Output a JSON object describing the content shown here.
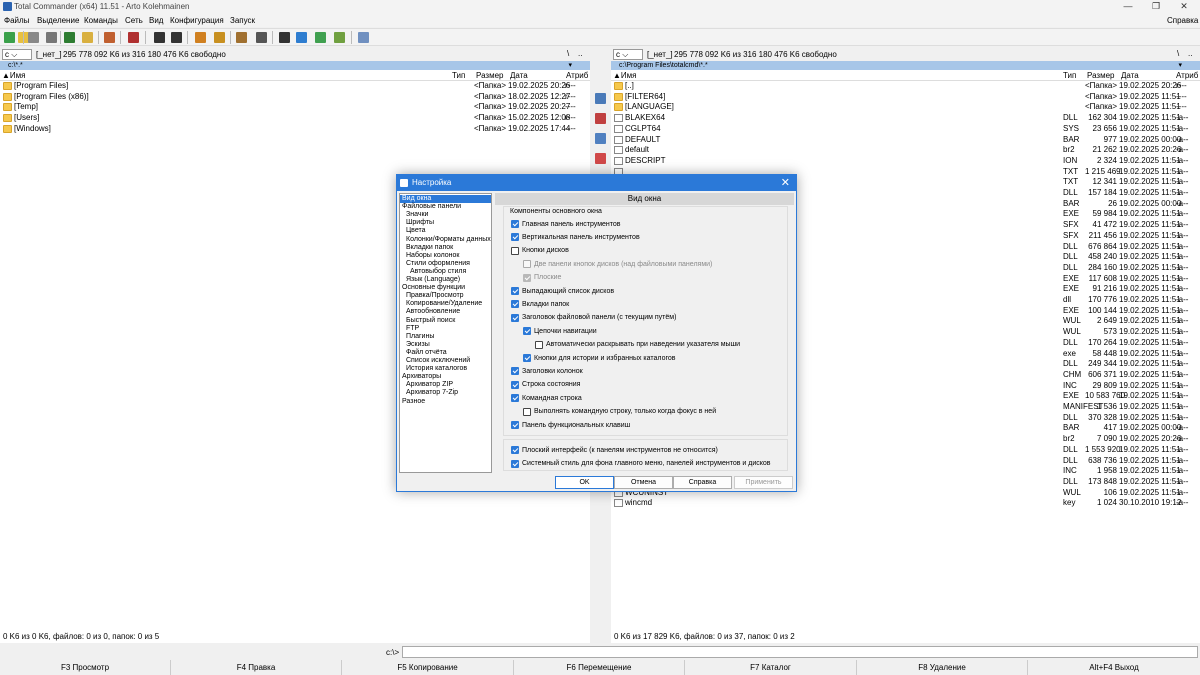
{
  "window": {
    "title": "Total Commander (x64) 11.51 - Arto Kolehmainen"
  },
  "menu": [
    "Файлы",
    "Выделение",
    "Команды",
    "Сеть",
    "Вид",
    "Конфигурация",
    "Запуск"
  ],
  "menu_help": "Справка",
  "left": {
    "drive": "c",
    "drive_label": "[_нет_]",
    "free": "295 778 092 K6 из 316 180 476 K6 свободно",
    "path": "c:\\*.*",
    "cols": {
      "name": "Имя",
      "type": "Тип",
      "size": "Размер",
      "date": "Дата",
      "attr": "Атриб"
    },
    "rows": [
      {
        "name": "[Program Files]",
        "size": "<Папка>",
        "date": "19.02.2025 20:26",
        "attr": "r---"
      },
      {
        "name": "[Program Files (x86)]",
        "size": "<Папка>",
        "date": "18.02.2025 12:27",
        "attr": "r---"
      },
      {
        "name": "[Temp]",
        "size": "<Папка>",
        "date": "19.02.2025 20:27",
        "attr": "----"
      },
      {
        "name": "[Users]",
        "size": "<Папка>",
        "date": "15.02.2025 12:08",
        "attr": "r---"
      },
      {
        "name": "[Windows]",
        "size": "<Папка>",
        "date": "19.02.2025 17:44",
        "attr": "----"
      }
    ],
    "status": "0 K6 из 0 K6, файлов: 0 из 0, папок: 0 из 5",
    "slash": "\\",
    "dots": ".."
  },
  "right": {
    "drive": "c",
    "drive_label": "[_нет_]",
    "free": "295 778 092 K6 из 316 180 476 K6 свободно",
    "path": "c:\\Program Files\\totalcmd\\*.*",
    "cols": {
      "name": "Имя",
      "type": "Тип",
      "size": "Размер",
      "date": "Дата",
      "attr": "Атриб"
    },
    "rows": [
      {
        "name": "[..]",
        "type": "",
        "size": "<Папка>",
        "date": "19.02.2025 20:26",
        "attr": "r---",
        "folder": true
      },
      {
        "name": "[FILTER64]",
        "type": "",
        "size": "<Папка>",
        "date": "19.02.2025 11:51",
        "attr": "----",
        "folder": true
      },
      {
        "name": "[LANGUAGE]",
        "type": "",
        "size": "<Папка>",
        "date": "19.02.2025 11:51",
        "attr": "----",
        "folder": true
      },
      {
        "name": "BLAKEX64",
        "type": "DLL",
        "size": "162 304",
        "date": "19.02.2025 11:51",
        "attr": "-a--"
      },
      {
        "name": "CGLPT64",
        "type": "SYS",
        "size": "23 656",
        "date": "19.02.2025 11:51",
        "attr": "-a--"
      },
      {
        "name": "DEFAULT",
        "type": "BAR",
        "size": "977",
        "date": "19.02.2025 00:00",
        "attr": "-a--"
      },
      {
        "name": "default",
        "type": "br2",
        "size": "21 262",
        "date": "19.02.2025 20:26",
        "attr": "-a--"
      },
      {
        "name": "DESCRIPT",
        "type": "ION",
        "size": "2 324",
        "date": "19.02.2025 11:51",
        "attr": "-a--"
      },
      {
        "name": "",
        "type": "TXT",
        "size": "1 215 469",
        "date": "19.02.2025 11:51",
        "attr": "-a--"
      },
      {
        "name": "",
        "type": "TXT",
        "size": "12 341",
        "date": "19.02.2025 11:51",
        "attr": "-a--"
      },
      {
        "name": "",
        "type": "DLL",
        "size": "157 184",
        "date": "19.02.2025 11:51",
        "attr": "-a--"
      },
      {
        "name": "",
        "type": "BAR",
        "size": "26",
        "date": "19.02.2025 00:00",
        "attr": "-a--"
      },
      {
        "name": "",
        "type": "EXE",
        "size": "59 984",
        "date": "19.02.2025 11:51",
        "attr": "-a--"
      },
      {
        "name": "",
        "type": "SFX",
        "size": "41 472",
        "date": "19.02.2025 11:51",
        "attr": "-a--"
      },
      {
        "name": "",
        "type": "SFX",
        "size": "211 456",
        "date": "19.02.2025 11:51",
        "attr": "-a--"
      },
      {
        "name": "",
        "type": "DLL",
        "size": "676 864",
        "date": "19.02.2025 11:51",
        "attr": "-a--"
      },
      {
        "name": "",
        "type": "DLL",
        "size": "458 240",
        "date": "19.02.2025 11:51",
        "attr": "-a--"
      },
      {
        "name": "",
        "type": "DLL",
        "size": "284 160",
        "date": "19.02.2025 11:51",
        "attr": "-a--"
      },
      {
        "name": "",
        "type": "EXE",
        "size": "117 608",
        "date": "19.02.2025 11:51",
        "attr": "-a--"
      },
      {
        "name": "",
        "type": "EXE",
        "size": "91 216",
        "date": "19.02.2025 11:51",
        "attr": "-a--"
      },
      {
        "name": "",
        "type": "dll",
        "size": "170 776",
        "date": "19.02.2025 11:51",
        "attr": "-a--"
      },
      {
        "name": "",
        "type": "EXE",
        "size": "100 144",
        "date": "19.02.2025 11:51",
        "attr": "-a--"
      },
      {
        "name": "",
        "type": "WUL",
        "size": "2 649",
        "date": "19.02.2025 11:51",
        "attr": "-a--"
      },
      {
        "name": "",
        "type": "WUL",
        "size": "573",
        "date": "19.02.2025 11:51",
        "attr": "-a--"
      },
      {
        "name": "",
        "type": "DLL",
        "size": "170 264",
        "date": "19.02.2025 11:51",
        "attr": "-a--"
      },
      {
        "name": "",
        "type": "exe",
        "size": "58 448",
        "date": "19.02.2025 11:51",
        "attr": "-a--"
      },
      {
        "name": "",
        "type": "DLL",
        "size": "249 344",
        "date": "19.02.2025 11:51",
        "attr": "-a--"
      },
      {
        "name": "",
        "type": "CHM",
        "size": "606 371",
        "date": "19.02.2025 11:51",
        "attr": "-a--"
      },
      {
        "name": "",
        "type": "INC",
        "size": "29 809",
        "date": "19.02.2025 11:51",
        "attr": "-a--"
      },
      {
        "name": "",
        "type": "EXE",
        "size": "10 583 760",
        "date": "19.02.2025 11:51",
        "attr": "-a--"
      },
      {
        "name": "",
        "type": "MANIFEST",
        "size": "1 536",
        "date": "19.02.2025 11:51",
        "attr": "-a--"
      },
      {
        "name": "",
        "type": "DLL",
        "size": "370 328",
        "date": "19.02.2025 11:51",
        "attr": "-a--"
      },
      {
        "name": "",
        "type": "BAR",
        "size": "417",
        "date": "19.02.2025 00:00",
        "attr": "-a--"
      },
      {
        "name": "",
        "type": "br2",
        "size": "7 090",
        "date": "19.02.2025 20:26",
        "attr": "-a--"
      },
      {
        "name": "",
        "type": "DLL",
        "size": "1 553 920",
        "date": "19.02.2025 11:51",
        "attr": "-a--"
      },
      {
        "name": "",
        "type": "DLL",
        "size": "638 736",
        "date": "19.02.2025 11:51",
        "attr": "-a--"
      },
      {
        "name": "",
        "type": "INC",
        "size": "1 958",
        "date": "19.02.2025 11:51",
        "attr": "-a--"
      },
      {
        "name": "",
        "type": "DLL",
        "size": "173 848",
        "date": "19.02.2025 11:51",
        "attr": "-a--"
      },
      {
        "name": "WCUNINST",
        "type": "WUL",
        "size": "106",
        "date": "19.02.2025 11:51",
        "attr": "-a--"
      },
      {
        "name": "wincmd",
        "type": "key",
        "size": "1 024",
        "date": "30.10.2010 19:12",
        "attr": "-a--"
      }
    ],
    "status": "0 K6 из 17 829 K6, файлов: 0 из 37, папок: 0 из 2",
    "slash": "\\",
    "dots": ".."
  },
  "cmdline": {
    "prompt": "c:\\>",
    "value": ""
  },
  "fkeys": [
    "F3 Просмотр",
    "F4 Правка",
    "F5 Копирование",
    "F6 Перемещение",
    "F7 Каталог",
    "F8 Удаление",
    "Alt+F4 Выход"
  ],
  "dialog": {
    "title": "Настройка",
    "close": "✕",
    "page_title": "Вид окна",
    "group_label": "Компоненты основного окна",
    "tree": [
      {
        "label": "Вид окна",
        "level": 0,
        "selected": true
      },
      {
        "label": "Файловые панели",
        "level": 0
      },
      {
        "label": "Значки",
        "level": 1
      },
      {
        "label": "Шрифты",
        "level": 1
      },
      {
        "label": "Цвета",
        "level": 1
      },
      {
        "label": "Колонки/Форматы данных",
        "level": 1
      },
      {
        "label": "Вкладки папок",
        "level": 1
      },
      {
        "label": "Наборы колонок",
        "level": 1
      },
      {
        "label": "Стили оформления",
        "level": 1
      },
      {
        "label": "Автовыбор стиля",
        "level": 2
      },
      {
        "label": "Язык (Language)",
        "level": 1
      },
      {
        "label": "Основные функции",
        "level": 0
      },
      {
        "label": "Правка/Просмотр",
        "level": 1
      },
      {
        "label": "Копирование/Удаление",
        "level": 1
      },
      {
        "label": "Автообновление",
        "level": 1
      },
      {
        "label": "Быстрый поиск",
        "level": 1
      },
      {
        "label": "FTP",
        "level": 1
      },
      {
        "label": "Плагины",
        "level": 1
      },
      {
        "label": "Эскизы",
        "level": 1
      },
      {
        "label": "Файл отчёта",
        "level": 1
      },
      {
        "label": "Список исключений",
        "level": 1
      },
      {
        "label": "История каталогов",
        "level": 1
      },
      {
        "label": "Архиваторы",
        "level": 0
      },
      {
        "label": "Архиватор ZIP",
        "level": 1
      },
      {
        "label": "Архиватор 7-Zip",
        "level": 1
      },
      {
        "label": "Разное",
        "level": 0
      }
    ],
    "options": [
      {
        "label": "Главная панель инструментов",
        "checked": true,
        "indent": 0,
        "disabled": false
      },
      {
        "label": "Вертикальная панель инструментов",
        "checked": true,
        "indent": 0,
        "disabled": false
      },
      {
        "label": "Кнопки дисков",
        "checked": false,
        "indent": 0,
        "disabled": false
      },
      {
        "label": "Две панели кнопок дисков (над файловыми панелями)",
        "checked": false,
        "indent": 1,
        "disabled": true
      },
      {
        "label": "Плоские",
        "checked": true,
        "indent": 1,
        "disabled": true
      },
      {
        "label": "Выпадающий список дисков",
        "checked": true,
        "indent": 0,
        "disabled": false
      },
      {
        "label": "Вкладки папок",
        "checked": true,
        "indent": 0,
        "disabled": false
      },
      {
        "label": "Заголовок файловой панели (с текущим путём)",
        "checked": true,
        "indent": 0,
        "disabled": false
      },
      {
        "label": "Цепочки навигации",
        "checked": true,
        "indent": 1,
        "disabled": false
      },
      {
        "label": "Автоматически раскрывать при наведении указателя мыши",
        "checked": false,
        "indent": 2,
        "disabled": false
      },
      {
        "label": "Кнопки для истории и избранных каталогов",
        "checked": true,
        "indent": 1,
        "disabled": false
      },
      {
        "label": "Заголовки колонок",
        "checked": true,
        "indent": 0,
        "disabled": false
      },
      {
        "label": "Строка состояния",
        "checked": true,
        "indent": 0,
        "disabled": false
      },
      {
        "label": "Командная строка",
        "checked": true,
        "indent": 0,
        "disabled": false
      },
      {
        "label": "Выполнять командную строку, только когда фокус в ней",
        "checked": false,
        "indent": 1,
        "disabled": false
      },
      {
        "label": "Панель функциональных клавиш",
        "checked": true,
        "indent": 0,
        "disabled": false
      }
    ],
    "options2": [
      {
        "label": "Плоский интерфейс (к панелям инструментов не относится)",
        "checked": true
      },
      {
        "label": "Системный стиль для фона главного меню, панелей инструментов и дисков",
        "checked": true
      }
    ],
    "buttons": {
      "ok": "OK",
      "cancel": "Отмена",
      "help": "Справка",
      "apply": "Применить"
    }
  }
}
